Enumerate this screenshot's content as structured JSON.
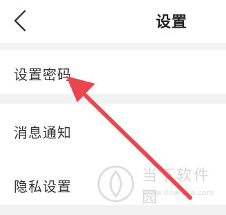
{
  "header": {
    "title": "设置",
    "back_icon": "chevron-left-icon"
  },
  "settings": {
    "items": [
      {
        "label": "设置密码"
      },
      {
        "label": "消息通知"
      },
      {
        "label": "隐私设置"
      }
    ]
  },
  "annotation": {
    "arrow_color": "#e8474f"
  },
  "watermark": {
    "title": "当下软件园",
    "url": "www.downxia.com"
  }
}
